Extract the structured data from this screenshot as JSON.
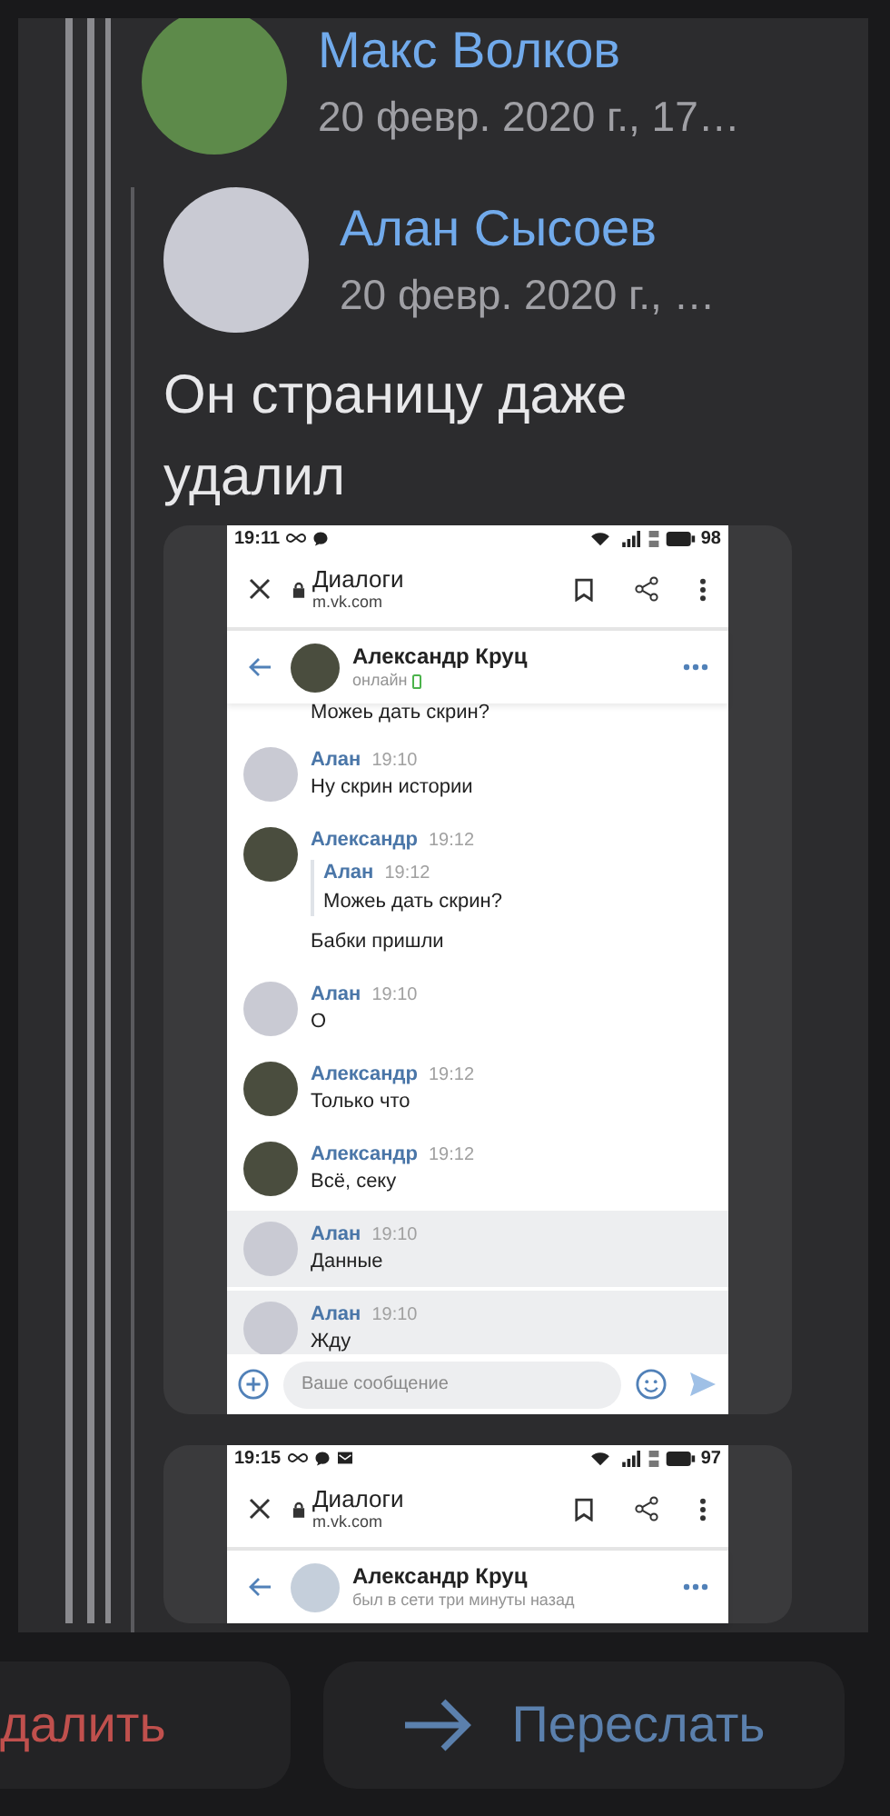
{
  "posts": [
    {
      "author": "Макс Волков",
      "date": "20 февр. 2020 г., 17…",
      "avatar": {
        "kind": "max"
      }
    },
    {
      "author": "Алан Сысоев",
      "date": "20 февр. 2020 г., …",
      "avatar": {
        "kind": "alan"
      },
      "text": "Он страницу даже удалил"
    }
  ],
  "screenshots": [
    {
      "time": "19:11",
      "notifications": [
        {
          "kind": "link"
        },
        {
          "kind": "chat"
        }
      ],
      "battery": "98",
      "browser_title": "Диалоги",
      "browser_url": "m.vk.com",
      "chat_name": "Александр Круц",
      "chat_status": "онлайн",
      "online": true,
      "contact_avatar": {
        "kind": "photo"
      },
      "partial_message": "Можеь дать скрин?",
      "messages": [
        {
          "author": "Алан",
          "time": "19:10",
          "text": "Ну скрин истории",
          "avatar": {
            "kind": "alan"
          },
          "highlighted": false
        },
        {
          "author": "Александр",
          "time": "19:12",
          "quote": {
            "author": "Алан",
            "time": "19:12",
            "text": "Можеь дать скрин?"
          },
          "text": "Бабки пришли",
          "avatar": {
            "kind": "aleksandr"
          },
          "highlighted": false
        },
        {
          "author": "Алан",
          "time": "19:10",
          "text": "О",
          "avatar": {
            "kind": "alan"
          },
          "highlighted": false
        },
        {
          "author": "Александр",
          "time": "19:12",
          "text": "Только что",
          "avatar": {
            "kind": "aleksandr"
          },
          "highlighted": false
        },
        {
          "author": "Александр",
          "time": "19:12",
          "text": "Всё, секу",
          "avatar": {
            "kind": "aleksandr"
          },
          "highlighted": false
        },
        {
          "author": "Алан",
          "time": "19:10",
          "text": "Данные",
          "avatar": {
            "kind": "alan"
          },
          "highlighted": true
        },
        {
          "author": "Алан",
          "time": "19:10",
          "text": "Жду",
          "avatar": {
            "kind": "alan"
          },
          "highlighted": true
        }
      ],
      "input_placeholder": "Ваше сообщение"
    },
    {
      "time": "19:15",
      "notifications": [
        {
          "kind": "link"
        },
        {
          "kind": "chat"
        },
        {
          "kind": "mail"
        }
      ],
      "battery": "97",
      "browser_title": "Диалоги",
      "browser_url": "m.vk.com",
      "chat_name": "Александр Круц",
      "chat_status": "был в сети три минуты назад",
      "online": false,
      "contact_avatar": {
        "kind": "default"
      }
    }
  ],
  "actions": [
    {
      "kind": "delete",
      "label": "далить"
    },
    {
      "kind": "forward",
      "label": "Переслать"
    }
  ]
}
